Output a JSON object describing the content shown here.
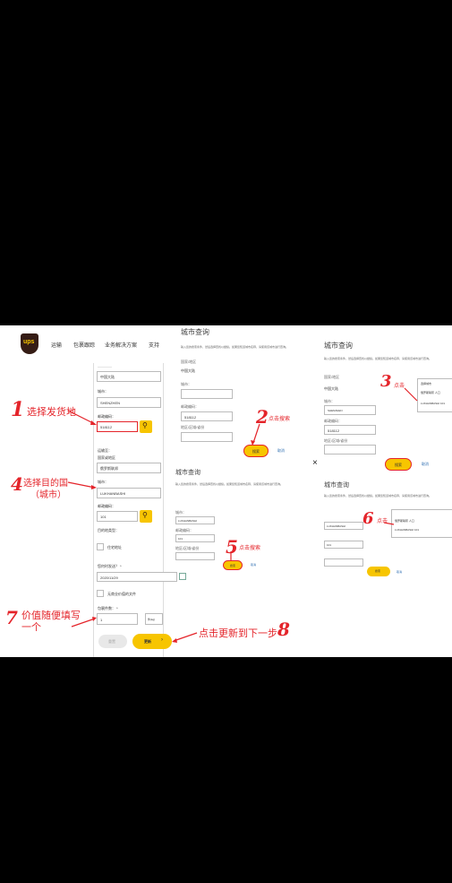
{
  "nav": {
    "logo": "ups",
    "items": [
      "运输",
      "包裹跟踪",
      "业务解决方案",
      "支持"
    ]
  },
  "form": {
    "from_country_value": "中国大陆",
    "from_city_label": "城市：",
    "from_city_value": "SHENZHEN",
    "from_postal_label": "邮政编码：",
    "from_postal_value": "518112",
    "to_heading": "运输至：",
    "to_country_label": "国家或地区",
    "to_country_value": "俄罗斯联邦",
    "to_city_label": "城市：",
    "to_city_value": "LUKHANBASHI",
    "to_postal_label": "邮政编码：",
    "to_postal_value": "101",
    "dest_type_label": "目的地类型：",
    "residential_label": "住宅地址",
    "ship_date_label": "您何时发送？ *",
    "ship_date_value": "2020/11/29",
    "no_docs_label": "无商业价值的文件",
    "pkg_count_label": "包裹件数： *",
    "pkg_count_value": "1",
    "unit_value": "件(kg)",
    "reset_button": "重置",
    "update_button": "更新"
  },
  "city_lookup": {
    "title": "城市查询",
    "description": "输入您的搜索条件，然后选择查找以继续。如果您知道城市名称，请使用该城市进行查询。",
    "country_label": "国家/地区",
    "country_value": "中国大陆",
    "city_label": "城市：",
    "city_value": "SHENZHEN",
    "postal_label": "邮政编码：",
    "postal_value": "518112",
    "district_label": "地区/区域/省份",
    "search_button": "搜索",
    "cancel_link": "取消",
    "dest_city_value": "LUKHANBASHI",
    "dest_postal_value": "101",
    "results_placeholder": "选择城市",
    "result_1": "俄罗斯联邦 人口",
    "result_2": "LUKHANBASHI 101"
  },
  "annotations": {
    "step1": "1",
    "step1_text": "选择发货地",
    "step2": "2",
    "step2_text": "点击搜索",
    "step3": "3",
    "step3_text": "点击",
    "step4": "4",
    "step4_text": "选择目的国",
    "step4_sub": "（城市）",
    "step5": "5",
    "step5_text": "点击搜索",
    "step6": "6",
    "step6_text": "点击",
    "step7": "7",
    "step7_text": "价值随便填写一个",
    "step8": "8",
    "step8_text": "点击更新到下一步"
  },
  "close_icon": "×",
  "colors": {
    "accent": "#f7c500",
    "annotation": "#e4242a",
    "brand": "#351c15"
  }
}
